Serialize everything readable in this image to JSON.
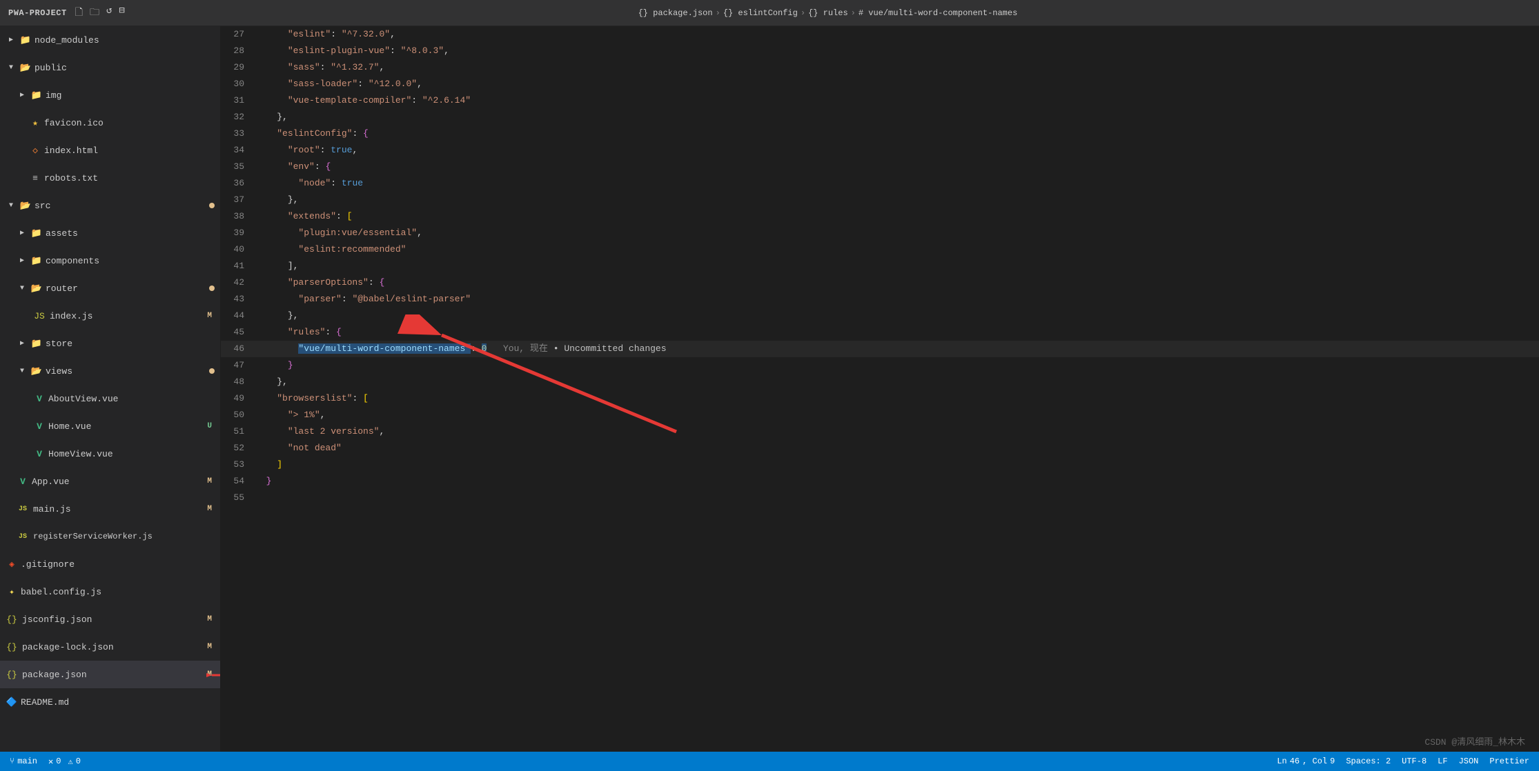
{
  "titlebar": {
    "project": "PWA-PROJECT",
    "breadcrumb": [
      {
        "label": "{} package.json",
        "sep": "›"
      },
      {
        "label": "{} eslintConfig",
        "sep": "›"
      },
      {
        "label": "{} rules",
        "sep": "›"
      },
      {
        "label": "# vue/multi-word-component-names",
        "sep": ""
      }
    ]
  },
  "sidebar": {
    "items": [
      {
        "id": "node_modules",
        "label": "node_modules",
        "indent": 0,
        "type": "folder",
        "collapsed": true,
        "badge": ""
      },
      {
        "id": "public",
        "label": "public",
        "indent": 0,
        "type": "folder-open",
        "collapsed": false,
        "badge": ""
      },
      {
        "id": "img",
        "label": "img",
        "indent": 1,
        "type": "folder",
        "collapsed": true,
        "badge": ""
      },
      {
        "id": "favicon",
        "label": "favicon.ico",
        "indent": 1,
        "type": "favicon",
        "badge": ""
      },
      {
        "id": "index-html",
        "label": "index.html",
        "indent": 1,
        "type": "html",
        "badge": ""
      },
      {
        "id": "robots",
        "label": "robots.txt",
        "indent": 1,
        "type": "txt",
        "badge": ""
      },
      {
        "id": "src",
        "label": "src",
        "indent": 0,
        "type": "folder-open",
        "collapsed": false,
        "badge": "dot"
      },
      {
        "id": "assets",
        "label": "assets",
        "indent": 1,
        "type": "folder",
        "collapsed": true,
        "badge": ""
      },
      {
        "id": "components",
        "label": "components",
        "indent": 1,
        "type": "folder",
        "collapsed": true,
        "badge": ""
      },
      {
        "id": "router",
        "label": "router",
        "indent": 1,
        "type": "folder-open",
        "collapsed": false,
        "badge": "dot"
      },
      {
        "id": "router-index",
        "label": "index.js",
        "indent": 2,
        "type": "js",
        "badge": "M"
      },
      {
        "id": "store",
        "label": "store",
        "indent": 1,
        "type": "folder",
        "collapsed": true,
        "badge": ""
      },
      {
        "id": "views",
        "label": "views",
        "indent": 1,
        "type": "folder-open",
        "collapsed": false,
        "badge": "dot"
      },
      {
        "id": "aboutview",
        "label": "AboutView.vue",
        "indent": 2,
        "type": "vue",
        "badge": ""
      },
      {
        "id": "homeview-vue",
        "label": "Home.vue",
        "indent": 2,
        "type": "vue",
        "badge": "U"
      },
      {
        "id": "homeview2",
        "label": "HomeView.vue",
        "indent": 2,
        "type": "vue",
        "badge": ""
      },
      {
        "id": "appvue",
        "label": "App.vue",
        "indent": 1,
        "type": "vue",
        "badge": "M"
      },
      {
        "id": "mainjs",
        "label": "main.js",
        "indent": 1,
        "type": "js",
        "badge": "M"
      },
      {
        "id": "registerSW",
        "label": "registerServiceWorker.js",
        "indent": 1,
        "type": "js",
        "badge": ""
      },
      {
        "id": "gitignore",
        "label": ".gitignore",
        "indent": 0,
        "type": "git",
        "badge": ""
      },
      {
        "id": "babelconfig",
        "label": "babel.config.js",
        "indent": 0,
        "type": "babel",
        "badge": ""
      },
      {
        "id": "jsconfigjson",
        "label": "jsconfig.json",
        "indent": 0,
        "type": "json",
        "badge": "M"
      },
      {
        "id": "packagelock",
        "label": "package-lock.json",
        "indent": 0,
        "type": "json",
        "badge": "M"
      },
      {
        "id": "packagejson",
        "label": "package.json",
        "indent": 0,
        "type": "json",
        "badge": "M",
        "active": true
      },
      {
        "id": "readme",
        "label": "README.md",
        "indent": 0,
        "type": "md",
        "badge": ""
      }
    ]
  },
  "editor": {
    "lines": [
      {
        "num": 27,
        "tokens": [
          {
            "t": "      "
          },
          {
            "t": "\"eslint\"",
            "c": "s-string"
          },
          {
            "t": ": ",
            "c": "s-punct"
          },
          {
            "t": "\"^7.32.0\"",
            "c": "s-string"
          },
          {
            "t": ",",
            "c": "s-punct"
          }
        ]
      },
      {
        "num": 28,
        "tokens": [
          {
            "t": "      "
          },
          {
            "t": "\"eslint-plugin-vue\"",
            "c": "s-string"
          },
          {
            "t": ": ",
            "c": "s-punct"
          },
          {
            "t": "\"^8.0.3\"",
            "c": "s-string"
          },
          {
            "t": ",",
            "c": "s-punct"
          }
        ]
      },
      {
        "num": 29,
        "tokens": [
          {
            "t": "      "
          },
          {
            "t": "\"sass\"",
            "c": "s-string"
          },
          {
            "t": ": ",
            "c": "s-punct"
          },
          {
            "t": "\"^1.32.7\"",
            "c": "s-string"
          },
          {
            "t": ",",
            "c": "s-punct"
          }
        ]
      },
      {
        "num": 30,
        "tokens": [
          {
            "t": "      "
          },
          {
            "t": "\"sass-loader\"",
            "c": "s-string"
          },
          {
            "t": ": ",
            "c": "s-punct"
          },
          {
            "t": "\"^12.0.0\"",
            "c": "s-string"
          },
          {
            "t": ",",
            "c": "s-punct"
          }
        ]
      },
      {
        "num": 31,
        "tokens": [
          {
            "t": "      "
          },
          {
            "t": "\"vue-template-compiler\"",
            "c": "s-string"
          },
          {
            "t": ": ",
            "c": "s-punct"
          },
          {
            "t": "\"^2.6.14\"",
            "c": "s-string"
          }
        ]
      },
      {
        "num": 32,
        "tokens": [
          {
            "t": "    "
          },
          {
            "t": "},",
            "c": "s-punct"
          }
        ]
      },
      {
        "num": 33,
        "tokens": [
          {
            "t": "    "
          },
          {
            "t": "\"eslintConfig\"",
            "c": "s-string"
          },
          {
            "t": ": ",
            "c": "s-punct"
          },
          {
            "t": "{",
            "c": "s-brace"
          }
        ]
      },
      {
        "num": 34,
        "tokens": [
          {
            "t": "      "
          },
          {
            "t": "\"root\"",
            "c": "s-string"
          },
          {
            "t": ": ",
            "c": "s-punct"
          },
          {
            "t": "true",
            "c": "s-bool"
          },
          {
            "t": ",",
            "c": "s-punct"
          }
        ]
      },
      {
        "num": 35,
        "tokens": [
          {
            "t": "      "
          },
          {
            "t": "\"env\"",
            "c": "s-string"
          },
          {
            "t": ": ",
            "c": "s-punct"
          },
          {
            "t": "{",
            "c": "s-brace"
          }
        ]
      },
      {
        "num": 36,
        "tokens": [
          {
            "t": "        "
          },
          {
            "t": "\"node\"",
            "c": "s-string"
          },
          {
            "t": ": ",
            "c": "s-punct"
          },
          {
            "t": "true",
            "c": "s-bool"
          }
        ]
      },
      {
        "num": 37,
        "tokens": [
          {
            "t": "      "
          },
          {
            "t": "},",
            "c": "s-punct"
          }
        ]
      },
      {
        "num": 38,
        "tokens": [
          {
            "t": "      "
          },
          {
            "t": "\"extends\"",
            "c": "s-string"
          },
          {
            "t": ": ",
            "c": "s-punct"
          },
          {
            "t": "[",
            "c": "s-bracket"
          }
        ]
      },
      {
        "num": 39,
        "tokens": [
          {
            "t": "        "
          },
          {
            "t": "\"plugin:vue/essential\"",
            "c": "s-string"
          },
          {
            "t": ",",
            "c": "s-punct"
          }
        ]
      },
      {
        "num": 40,
        "tokens": [
          {
            "t": "        "
          },
          {
            "t": "\"eslint:recommended\"",
            "c": "s-string"
          }
        ]
      },
      {
        "num": 41,
        "tokens": [
          {
            "t": "      "
          },
          {
            "t": "],",
            "c": "s-punct"
          }
        ]
      },
      {
        "num": 42,
        "tokens": [
          {
            "t": "      "
          },
          {
            "t": "\"parserOptions\"",
            "c": "s-string"
          },
          {
            "t": ": ",
            "c": "s-punct"
          },
          {
            "t": "{",
            "c": "s-brace"
          }
        ]
      },
      {
        "num": 43,
        "tokens": [
          {
            "t": "        "
          },
          {
            "t": "\"parser\"",
            "c": "s-string"
          },
          {
            "t": ": ",
            "c": "s-punct"
          },
          {
            "t": "\"@babel/eslint-parser\"",
            "c": "s-string"
          }
        ]
      },
      {
        "num": 44,
        "tokens": [
          {
            "t": "      "
          },
          {
            "t": "},",
            "c": "s-punct"
          }
        ]
      },
      {
        "num": 45,
        "tokens": [
          {
            "t": "      "
          },
          {
            "t": "\"rules\"",
            "c": "s-string"
          },
          {
            "t": ": ",
            "c": "s-punct"
          },
          {
            "t": "{",
            "c": "s-brace"
          }
        ]
      },
      {
        "num": 46,
        "tokens": [
          {
            "t": "        "
          },
          {
            "t": "\"vue/multi-word-component-names\"",
            "c": "s-highlight-key"
          },
          {
            "t": ": ",
            "c": "s-punct"
          },
          {
            "t": "0",
            "c": "s-highlight-val"
          },
          {
            "t": "   ",
            "c": ""
          },
          {
            "t": "You, 现在",
            "c": "s-git-info"
          },
          {
            "t": " • ",
            "c": "s-git-dot"
          },
          {
            "t": "Uncommitted changes",
            "c": "s-git-change"
          }
        ],
        "active": true
      },
      {
        "num": 47,
        "tokens": [
          {
            "t": "      "
          },
          {
            "t": "}",
            "c": "s-brace"
          }
        ]
      },
      {
        "num": 48,
        "tokens": [
          {
            "t": "    "
          },
          {
            "t": "},",
            "c": "s-punct"
          }
        ]
      },
      {
        "num": 49,
        "tokens": [
          {
            "t": "    "
          },
          {
            "t": "\"browserslist\"",
            "c": "s-string"
          },
          {
            "t": ": ",
            "c": "s-punct"
          },
          {
            "t": "[",
            "c": "s-bracket"
          }
        ]
      },
      {
        "num": 50,
        "tokens": [
          {
            "t": "      "
          },
          {
            "t": "\"> 1%\"",
            "c": "s-string"
          },
          {
            "t": ",",
            "c": "s-punct"
          }
        ]
      },
      {
        "num": 51,
        "tokens": [
          {
            "t": "      "
          },
          {
            "t": "\"last 2 versions\"",
            "c": "s-string"
          },
          {
            "t": ",",
            "c": "s-punct"
          }
        ]
      },
      {
        "num": 52,
        "tokens": [
          {
            "t": "      "
          },
          {
            "t": "\"not dead\"",
            "c": "s-string"
          }
        ]
      },
      {
        "num": 53,
        "tokens": [
          {
            "t": "    "
          },
          {
            "t": "]",
            "c": "s-bracket"
          }
        ]
      },
      {
        "num": 54,
        "tokens": [
          {
            "t": "  "
          },
          {
            "t": "}",
            "c": "s-brace"
          }
        ]
      },
      {
        "num": 55,
        "tokens": []
      }
    ]
  },
  "bottombar": {
    "branch": "main",
    "errors": "0",
    "warnings": "0",
    "ln": "46",
    "col": "9",
    "spaces": "Spaces: 2",
    "encoding": "UTF-8",
    "eol": "LF",
    "language": "JSON",
    "prettier": "Prettier"
  },
  "watermark": "CSDN @清风细雨_林木木"
}
